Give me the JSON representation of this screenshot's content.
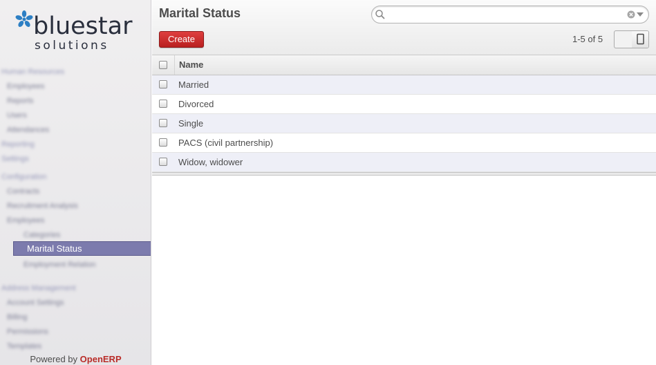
{
  "brand": {
    "name": "bluestar",
    "tagline": "solutions",
    "star_color": "#2d7fc4"
  },
  "sidebar": {
    "active_item": "Marital Status",
    "blurred_items": [
      {
        "label": "Human Resources",
        "level": 0
      },
      {
        "label": "Employees",
        "level": 1
      },
      {
        "label": "Reports",
        "level": 1
      },
      {
        "label": "Users",
        "level": 1
      },
      {
        "label": "Attendances",
        "level": 1
      },
      {
        "label": "Reporting",
        "level": 0
      },
      {
        "label": "Settings",
        "level": 0
      },
      {
        "label": "Configuration",
        "level": 0
      },
      {
        "label": "Contracts",
        "level": 1
      },
      {
        "label": "Recruitment Analysis",
        "level": 1
      },
      {
        "label": "Employees",
        "level": 1
      },
      {
        "label": "Categories",
        "level": 2
      },
      {
        "label": "Employment Relation",
        "level": 2
      },
      {
        "label": "Address Management",
        "level": 0
      },
      {
        "label": "Account Settings",
        "level": 1
      },
      {
        "label": "Billing",
        "level": 1
      },
      {
        "label": "Permissions",
        "level": 1
      },
      {
        "label": "Templates",
        "level": 1
      }
    ],
    "powered_prefix": "Powered by",
    "powered_brand": "OpenERP"
  },
  "header": {
    "title": "Marital Status",
    "search_placeholder": "",
    "create_label": "Create",
    "pager": "1-5 of 5"
  },
  "table": {
    "column_name": "Name",
    "rows": [
      "Married",
      "Divorced",
      "Single",
      "PACS (civil partnership)",
      "Widow, widower"
    ]
  },
  "colors": {
    "accent": "#7c7bad",
    "create_button": "#c9302c",
    "brand_link": "#b92c28"
  }
}
